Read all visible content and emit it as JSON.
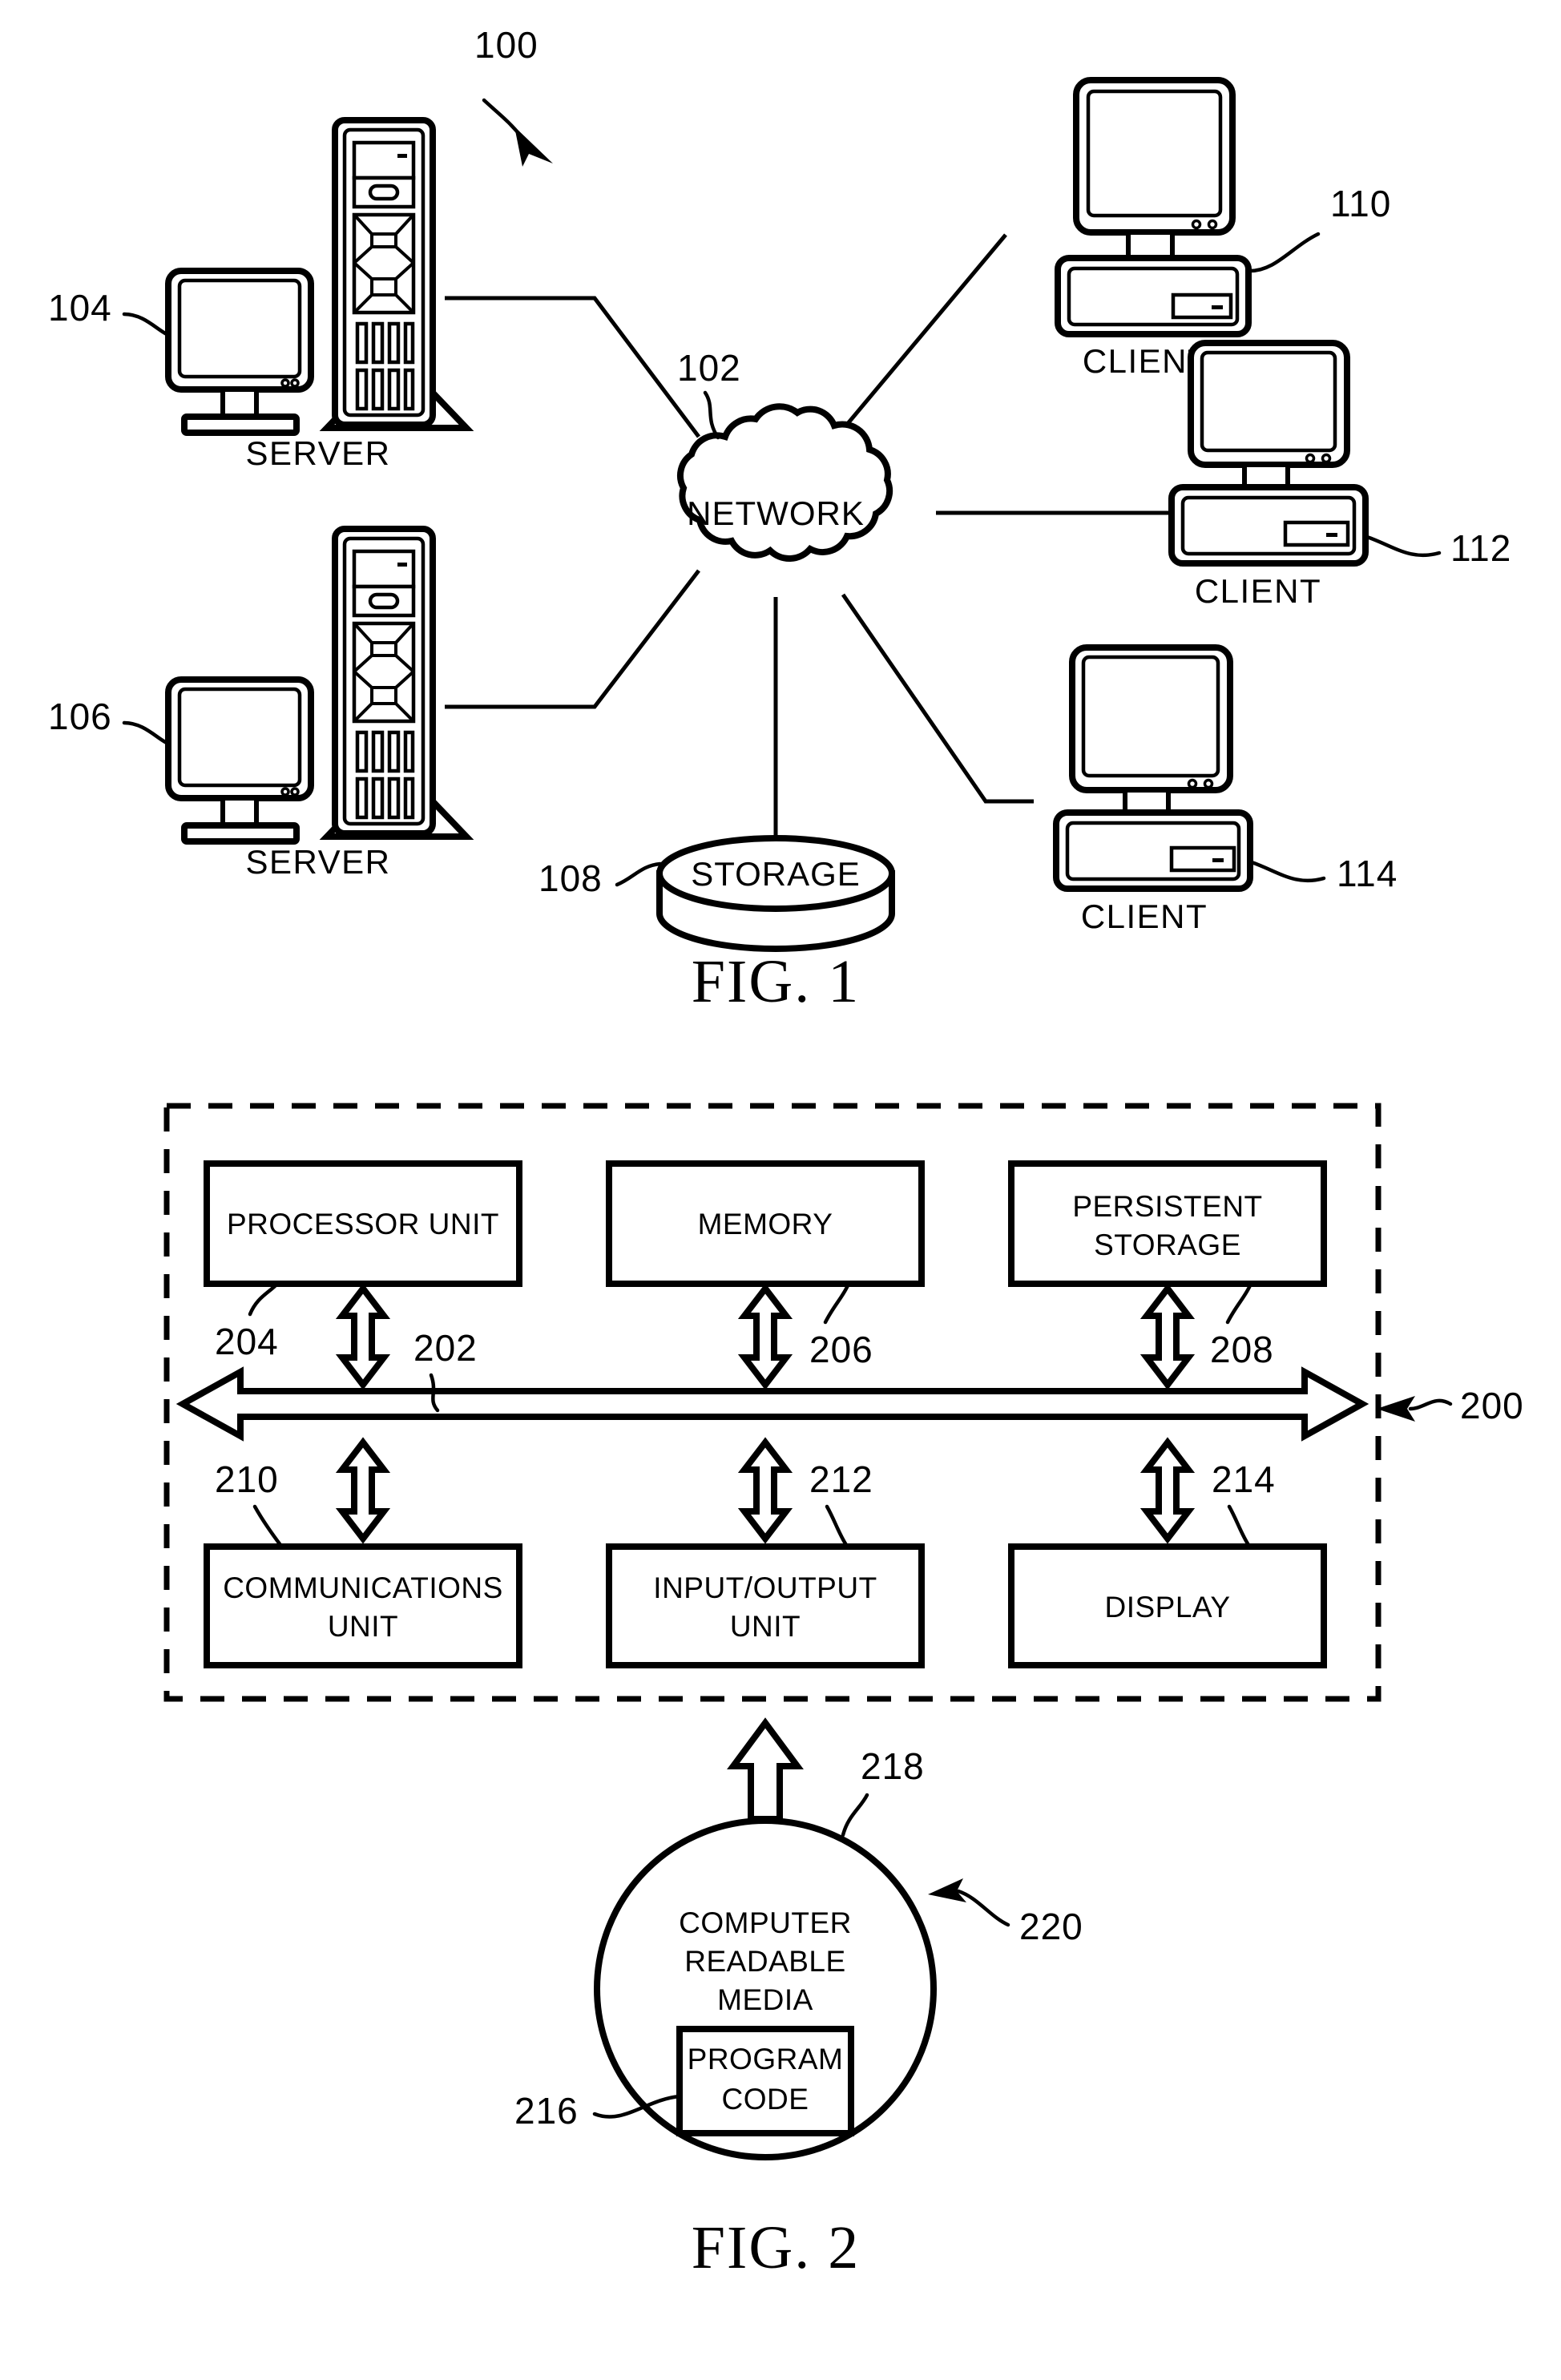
{
  "document": {
    "type": "patent-figure-sheet",
    "figures": [
      {
        "id": "fig1",
        "caption": "FIG. 1",
        "system_ref": "100",
        "nodes": [
          {
            "ref": "104",
            "label": "SERVER",
            "kind": "server"
          },
          {
            "ref": "106",
            "label": "SERVER",
            "kind": "server"
          },
          {
            "ref": "102",
            "label": "NETWORK",
            "kind": "cloud"
          },
          {
            "ref": "108",
            "label": "STORAGE",
            "kind": "cylinder"
          },
          {
            "ref": "110",
            "label": "CLIENT",
            "kind": "client"
          },
          {
            "ref": "112",
            "label": "CLIENT",
            "kind": "client"
          },
          {
            "ref": "114",
            "label": "CLIENT",
            "kind": "client"
          }
        ]
      },
      {
        "id": "fig2",
        "caption": "FIG. 2",
        "system_ref": "200",
        "bus_ref": "202",
        "blocks": [
          {
            "ref": "204",
            "label": "PROCESSOR UNIT",
            "line1": "PROCESSOR UNIT",
            "line2": ""
          },
          {
            "ref": "206",
            "label": "MEMORY",
            "line1": "MEMORY",
            "line2": ""
          },
          {
            "ref": "208",
            "label": "PERSISTENT STORAGE",
            "line1": "PERSISTENT",
            "line2": "STORAGE"
          },
          {
            "ref": "210",
            "label": "COMMUNICATIONS UNIT",
            "line1": "COMMUNICATIONS",
            "line2": "UNIT"
          },
          {
            "ref": "212",
            "label": "INPUT/OUTPUT UNIT",
            "line1": "INPUT/OUTPUT",
            "line2": "UNIT"
          },
          {
            "ref": "214",
            "label": "DISPLAY",
            "line1": "DISPLAY",
            "line2": ""
          }
        ],
        "media": {
          "ref": "218",
          "outer_ref": "220",
          "line1": "COMPUTER",
          "line2": "READABLE",
          "line3": "MEDIA",
          "program": {
            "ref": "216",
            "line1": "PROGRAM",
            "line2": "CODE"
          }
        }
      }
    ]
  },
  "colors": {
    "ink": "#000000",
    "paper": "#ffffff"
  }
}
